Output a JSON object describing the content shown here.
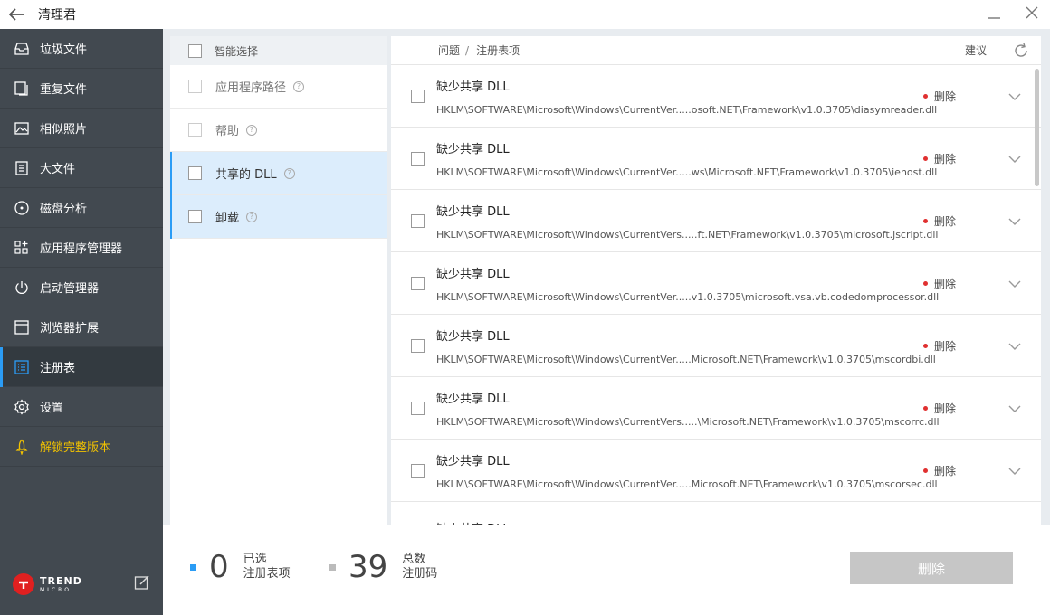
{
  "app": {
    "title": "清理君"
  },
  "sidebar": {
    "items": [
      {
        "label": "垃圾文件",
        "icon": "inbox-icon"
      },
      {
        "label": "重复文件",
        "icon": "duplicate-icon"
      },
      {
        "label": "相似照片",
        "icon": "photo-icon"
      },
      {
        "label": "大文件",
        "icon": "document-icon"
      },
      {
        "label": "磁盘分析",
        "icon": "disk-icon"
      },
      {
        "label": "应用程序管理器",
        "icon": "apps-grid-icon"
      },
      {
        "label": "启动管理器",
        "icon": "power-icon"
      },
      {
        "label": "浏览器扩展",
        "icon": "browser-icon"
      },
      {
        "label": "注册表",
        "icon": "registry-list-icon"
      },
      {
        "label": "设置",
        "icon": "gear-icon"
      },
      {
        "label": "解锁完整版本",
        "icon": "rocket-icon"
      }
    ],
    "active_index": 8,
    "brand": {
      "line1": "TREND",
      "line2": "MICRO"
    },
    "accent_color": "#2b9cf5",
    "unlock_color": "#f2c200"
  },
  "categories": {
    "header_label": "智能选择",
    "items": [
      {
        "label": "应用程序路径",
        "selected": false
      },
      {
        "label": "帮助",
        "selected": false
      },
      {
        "label": "共享的 DLL",
        "selected": true
      },
      {
        "label": "卸载",
        "selected": true
      }
    ]
  },
  "issues": {
    "header": {
      "crumb_problem": "问题",
      "crumb_separator": "/",
      "crumb_item": "注册表项",
      "suggest_label": "建议"
    },
    "rows": [
      {
        "title": "缺少共享 DLL",
        "path": "HKLM\\SOFTWARE\\Microsoft\\Windows\\CurrentVer.....osoft.NET\\Framework\\v1.0.3705\\diasymreader.dll",
        "action": "删除"
      },
      {
        "title": "缺少共享 DLL",
        "path": "HKLM\\SOFTWARE\\Microsoft\\Windows\\CurrentVer.....ws\\Microsoft.NET\\Framework\\v1.0.3705\\iehost.dll",
        "action": "删除"
      },
      {
        "title": "缺少共享 DLL",
        "path": "HKLM\\SOFTWARE\\Microsoft\\Windows\\CurrentVers.....ft.NET\\Framework\\v1.0.3705\\microsoft.jscript.dll",
        "action": "删除"
      },
      {
        "title": "缺少共享 DLL",
        "path": "HKLM\\SOFTWARE\\Microsoft\\Windows\\CurrentVer.....v1.0.3705\\microsoft.vsa.vb.codedomprocessor.dll",
        "action": "删除"
      },
      {
        "title": "缺少共享 DLL",
        "path": "HKLM\\SOFTWARE\\Microsoft\\Windows\\CurrentVer.....Microsoft.NET\\Framework\\v1.0.3705\\mscordbi.dll",
        "action": "删除"
      },
      {
        "title": "缺少共享 DLL",
        "path": "HKLM\\SOFTWARE\\Microsoft\\Windows\\CurrentVers.....\\Microsoft.NET\\Framework\\v1.0.3705\\mscorrc.dll",
        "action": "删除"
      },
      {
        "title": "缺少共享 DLL",
        "path": "HKLM\\SOFTWARE\\Microsoft\\Windows\\CurrentVer.....Microsoft.NET\\Framework\\v1.0.3705\\mscorsec.dll",
        "action": "删除"
      },
      {
        "title": "缺少共享 DLL",
        "path": "",
        "action": ""
      }
    ],
    "status_dot_color": "#e03030"
  },
  "footer": {
    "selected_count": "0",
    "selected_label_line1": "已选",
    "selected_label_line2": "注册表项",
    "selected_color": "#2b9cf5",
    "total_count": "39",
    "total_label_line1": "总数",
    "total_label_line2": "注册码",
    "total_color": "#bbbbbb",
    "delete_label": "删除"
  }
}
